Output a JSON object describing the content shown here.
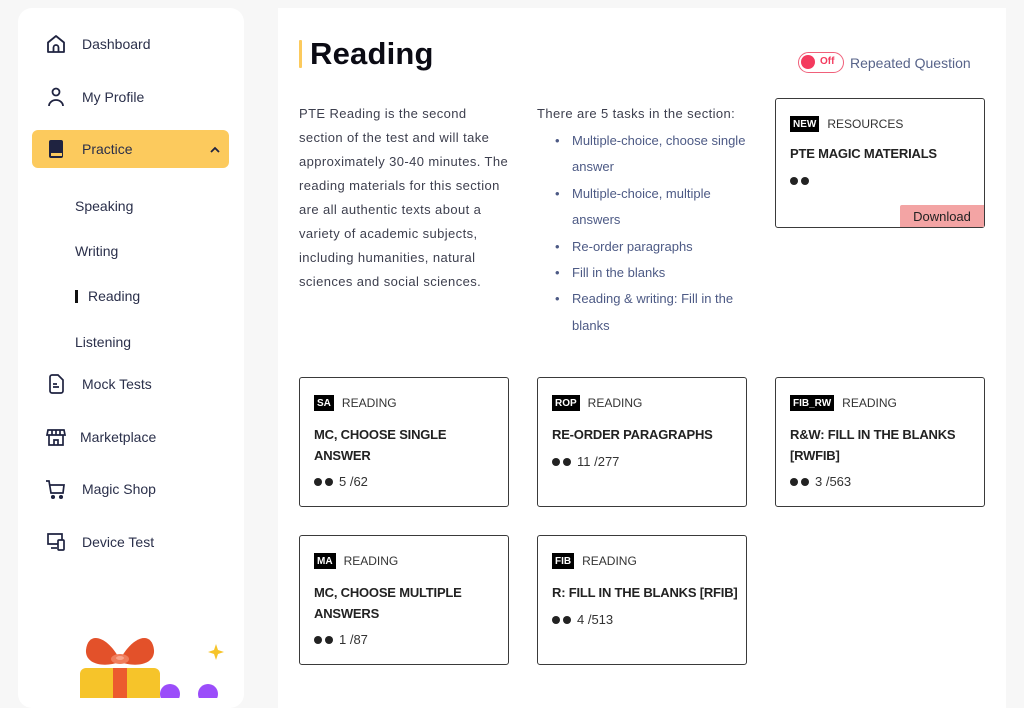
{
  "sidebar": {
    "items": [
      {
        "label": "Dashboard",
        "icon": "home-icon"
      },
      {
        "label": "My Profile",
        "icon": "user-icon"
      },
      {
        "label": "Practice",
        "icon": "book-icon",
        "active": true,
        "expanded": true
      },
      {
        "label": "Mock Tests",
        "icon": "document-icon"
      },
      {
        "label": "Marketplace",
        "icon": "store-icon"
      },
      {
        "label": "Magic Shop",
        "icon": "cart-icon"
      },
      {
        "label": "Device Test",
        "icon": "devices-icon"
      }
    ],
    "sub_items": [
      {
        "label": "Speaking"
      },
      {
        "label": "Writing"
      },
      {
        "label": "Reading",
        "active": true
      },
      {
        "label": "Listening"
      }
    ]
  },
  "main": {
    "title": "Reading",
    "toggle": {
      "state": "Off",
      "label": "Repeated Question"
    },
    "description": "PTE Reading is the second section of the test and will take approximately 30-40 minutes. The reading materials for this section are all authentic texts about a variety of academic subjects, including humanities, natural sciences and social sciences.",
    "tasks_intro": "There are 5 tasks in the section:",
    "tasks": [
      "Multiple-choice, choose single answer",
      "Multiple-choice, multiple answers",
      "Re-order paragraphs",
      "Fill in the blanks",
      "Reading & writing: Fill in the blanks"
    ],
    "resource_card": {
      "tag": "NEW",
      "category": "RESOURCES",
      "title": "PTE MAGIC MATERIALS",
      "button": "Download"
    },
    "cards": [
      {
        "tag": "SA",
        "category": "READING",
        "title": "MC, CHOOSE SINGLE ANSWER",
        "progress": "5 /62"
      },
      {
        "tag": "ROP",
        "category": "READING",
        "title": "RE-ORDER PARAGRAPHS",
        "progress": "11 /277"
      },
      {
        "tag": "FIB_RW",
        "category": "READING",
        "title": "R&W: FILL IN THE BLANKS [RWFIB]",
        "progress": "3 /563"
      },
      {
        "tag": "MA",
        "category": "READING",
        "title": "MC, CHOOSE MULTIPLE ANSWERS",
        "progress": "1 /87"
      },
      {
        "tag": "FIB",
        "category": "READING",
        "title": "R: FILL IN THE BLANKS [RFIB]",
        "progress": "4 /513"
      }
    ],
    "colors": {
      "accent": "#fcca5d",
      "toggle": "#f43a5e",
      "download": "#f3a4a4"
    }
  }
}
